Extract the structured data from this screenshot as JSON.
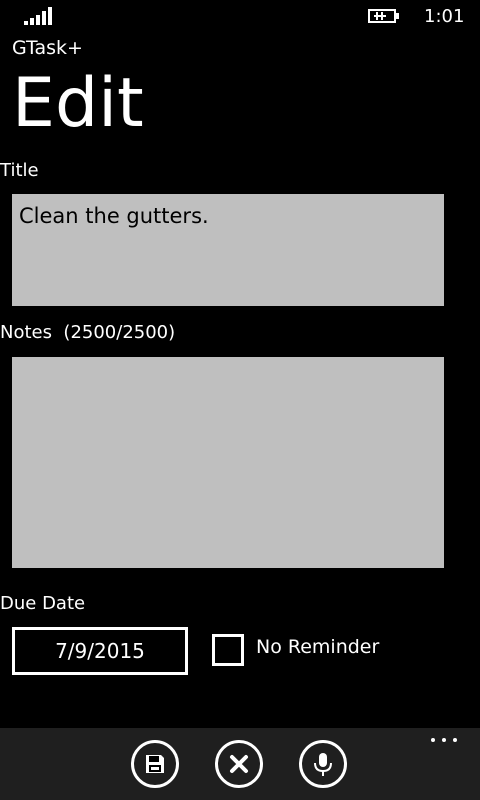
{
  "status_bar": {
    "time": "1:01",
    "signal_icon": "signal-bars-icon",
    "battery_icon": "battery-charging-icon"
  },
  "app": {
    "name": "GTask+",
    "page_title": "Edit"
  },
  "form": {
    "title_label": "Title",
    "title_value": "Clean the gutters.",
    "notes_label": "Notes  (2500/2500)",
    "notes_value": "",
    "due_label": "Due Date",
    "due_value": "7/9/2015",
    "no_reminder_label": "No Reminder",
    "no_reminder_checked": false
  },
  "app_bar": {
    "buttons": [
      {
        "icon": "save-icon"
      },
      {
        "icon": "close-icon"
      },
      {
        "icon": "microphone-icon"
      }
    ],
    "more_icon": "more-ellipsis-icon"
  },
  "colors": {
    "background": "#000000",
    "textbox": "#bfbfbf",
    "app_bar": "#1f1f1f"
  }
}
